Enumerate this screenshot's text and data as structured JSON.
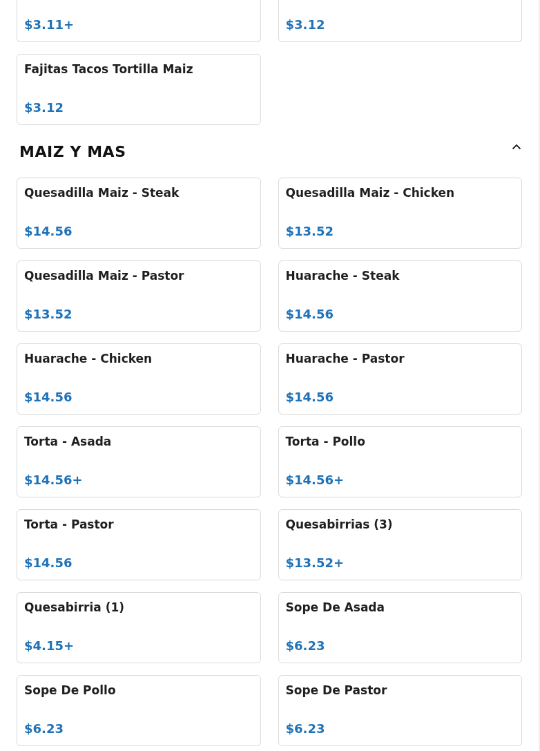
{
  "partial_items": [
    {
      "price": "$3.11+"
    },
    {
      "price": "$3.12"
    }
  ],
  "items": [
    {
      "name": "Fajitas Tacos Tortilla Maiz",
      "price": "$3.12"
    }
  ],
  "sections": [
    {
      "title": "MAIZ Y MAS",
      "expanded": true,
      "items": [
        {
          "name": "Quesadilla Maiz - Steak",
          "price": "$14.56"
        },
        {
          "name": "Quesadilla Maiz - Chicken",
          "price": "$13.52"
        },
        {
          "name": "Quesadilla Maiz - Pastor",
          "price": "$13.52"
        },
        {
          "name": "Huarache - Steak",
          "price": "$14.56"
        },
        {
          "name": "Huarache - Chicken",
          "price": "$14.56"
        },
        {
          "name": "Huarache - Pastor",
          "price": "$14.56"
        },
        {
          "name": "Torta - Asada",
          "price": "$14.56+"
        },
        {
          "name": "Torta - Pollo",
          "price": "$14.56+"
        },
        {
          "name": "Torta - Pastor",
          "price": "$14.56"
        },
        {
          "name": "Quesabirrias (3)",
          "price": "$13.52+"
        },
        {
          "name": "Quesabirria (1)",
          "price": "$4.15+"
        },
        {
          "name": "Sope De Asada",
          "price": "$6.23"
        },
        {
          "name": "Sope De Pollo",
          "price": "$6.23"
        },
        {
          "name": "Sope De Pastor",
          "price": "$6.23"
        }
      ]
    }
  ]
}
